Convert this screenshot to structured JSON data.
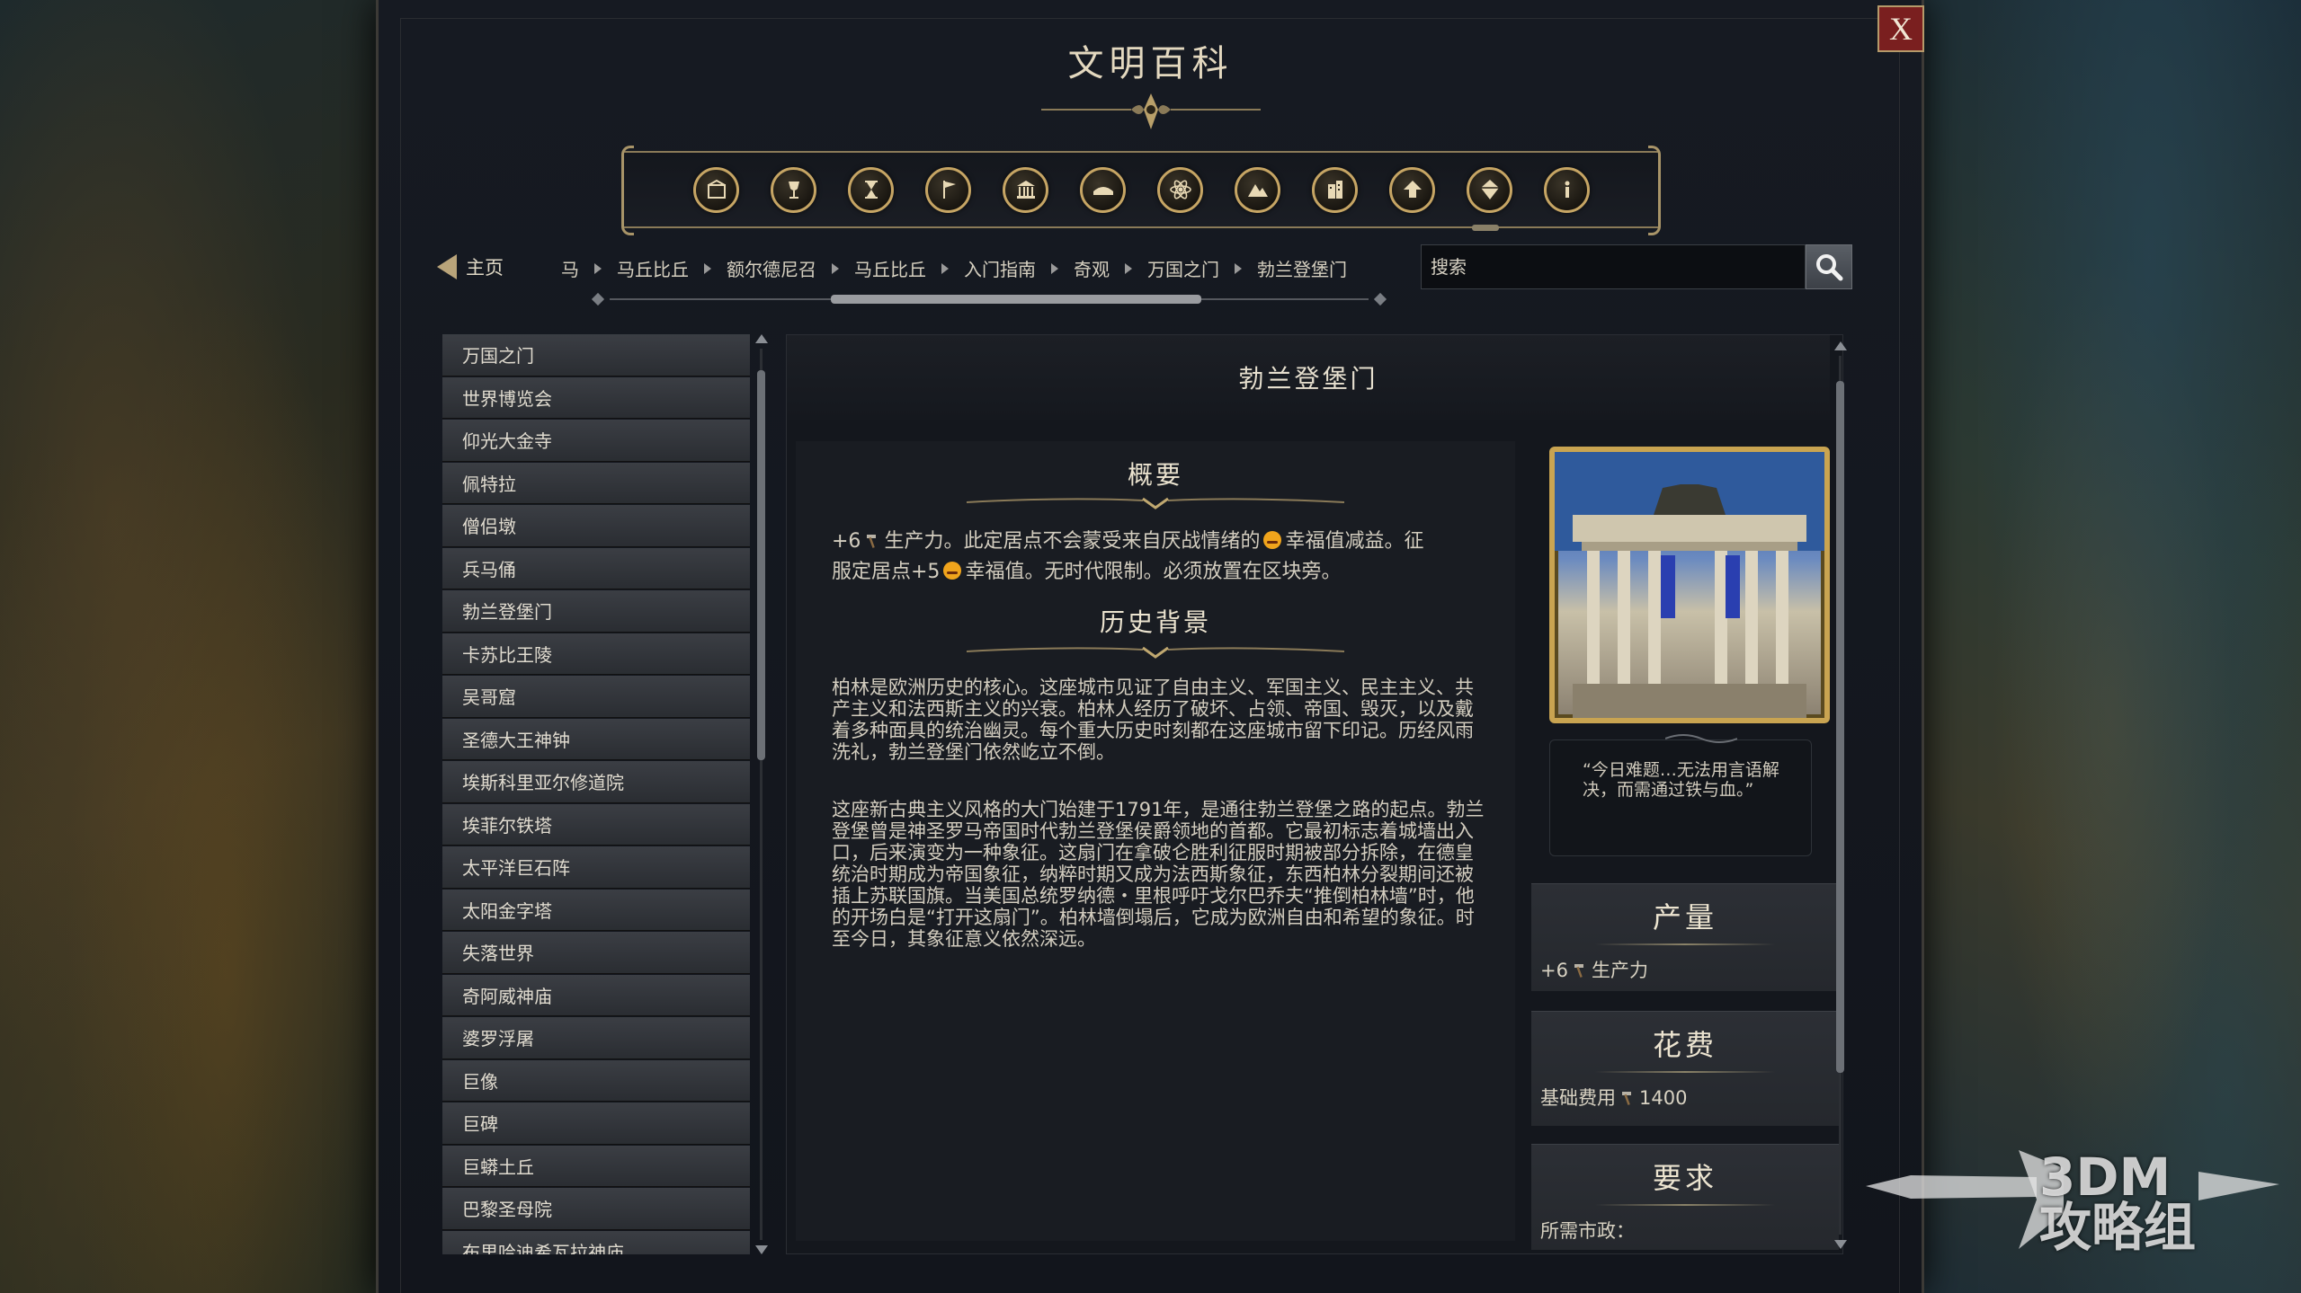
{
  "window": {
    "title": "文明百科",
    "close_label": "X"
  },
  "categories": [
    {
      "icon": "trade-goods-icon"
    },
    {
      "icon": "chalice-icon"
    },
    {
      "icon": "hourglass-icon"
    },
    {
      "icon": "flag-icon"
    },
    {
      "icon": "government-building-icon"
    },
    {
      "icon": "book-icon"
    },
    {
      "icon": "atom-icon"
    },
    {
      "icon": "mountain-icon"
    },
    {
      "icon": "city-building-icon"
    },
    {
      "icon": "upgrade-arrow-icon"
    },
    {
      "icon": "crystal-icon"
    },
    {
      "icon": "info-icon"
    }
  ],
  "navigation": {
    "home_label": "主页",
    "breadcrumbs": [
      "马",
      "马丘比丘",
      "额尔德尼召",
      "马丘比丘",
      "入门指南",
      "奇观",
      "万国之门",
      "勃兰登堡门"
    ]
  },
  "search": {
    "placeholder": "搜索"
  },
  "list": {
    "items": [
      "万国之门",
      "世界博览会",
      "仰光大金寺",
      "佩特拉",
      "僧侣墩",
      "兵马俑",
      "勃兰登堡门",
      "卡苏比王陵",
      "吴哥窟",
      "圣德大王神钟",
      "埃斯科里亚尔修道院",
      "埃菲尔铁塔",
      "太平洋巨石阵",
      "太阳金字塔",
      "失落世界",
      "奇阿威神庙",
      "婆罗浮屠",
      "巨像",
      "巨碑",
      "巨蟒土丘",
      "巴黎圣母院",
      "布里哈迪希瓦拉神庙"
    ]
  },
  "article": {
    "title": "勃兰登堡门",
    "overview_heading": "概要",
    "overview_line1_a": "+6",
    "overview_line1_b": "生产力。此定居点不会蒙受来自厌战情绪的",
    "overview_line1_c": "幸福值减益。征",
    "overview_line2_a": "服定居点+5",
    "overview_line2_b": "幸福值。无时代限制。必须放置在区块旁。",
    "history_heading": "历史背景",
    "history_p1": "柏林是欧洲历史的核心。这座城市见证了自由主义、军国主义、民主主义、共产主义和法西斯主义的兴衰。柏林人经历了破坏、占领、帝国、毁灭，以及戴着多种面具的统治幽灵。每个重大历史时刻都在这座城市留下印记。历经风雨洗礼，勃兰登堡门依然屹立不倒。",
    "history_p2": "这座新古典主义风格的大门始建于1791年，是通往勃兰登堡之路的起点。勃兰登堡曾是神圣罗马帝国时代勃兰登堡侯爵领地的首都。它最初标志着城墙出入口，后来演变为一种象征。这扇门在拿破仑胜利征服时期被部分拆除，在德皇统治时期成为帝国象征，纳粹时期又成为法西斯象征，东西柏林分裂期间还被插上苏联国旗。当美国总统罗纳德・里根呼吁戈尔巴乔夫“推倒柏林墙”时，他的开场白是“打开这扇门”。柏林墙倒塌后，它成为欧洲自由和希望的象征。时至今日，其象征意义依然深远。",
    "quote": "“今日难题…无法用言语解决，而需通过铁与血。”"
  },
  "yield": {
    "heading": "产量",
    "value": "+6",
    "label": "生产力"
  },
  "cost": {
    "heading": "花费",
    "label": "基础费用",
    "value": "1400"
  },
  "requirements": {
    "heading": "要求",
    "label": "所需市政："
  },
  "watermark": {
    "line1": "3DM",
    "line2": "攻略组"
  },
  "colors": {
    "accent_gold": "#c9a451",
    "panel_bg": "#14171d",
    "close_red": "#7a1f1f",
    "happiness": "#f0a41c"
  }
}
